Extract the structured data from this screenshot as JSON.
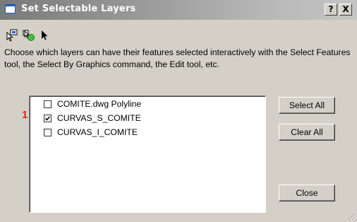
{
  "window": {
    "title": "Set Selectable Layers",
    "help_label": "?",
    "close_label": "X"
  },
  "toolbar": {
    "icons": [
      "select-features-icon",
      "select-by-graphics-icon",
      "edit-tool-icon"
    ]
  },
  "description": "Choose which layers can have their features selected interactively with the Select Features tool, the Select By Graphics command, the Edit tool, etc.",
  "layers": [
    {
      "label": "COMITE.dwg Polyline",
      "checked": false
    },
    {
      "label": "CURVAS_S_COMITE",
      "checked": true
    },
    {
      "label": "CURVAS_I_COMITE",
      "checked": false
    }
  ],
  "annotation": "1",
  "buttons": {
    "select_all": "Select All",
    "clear_all": "Clear All",
    "close": "Close"
  },
  "colors": {
    "face": "#d4d0c8",
    "annotation": "#e0201c"
  }
}
